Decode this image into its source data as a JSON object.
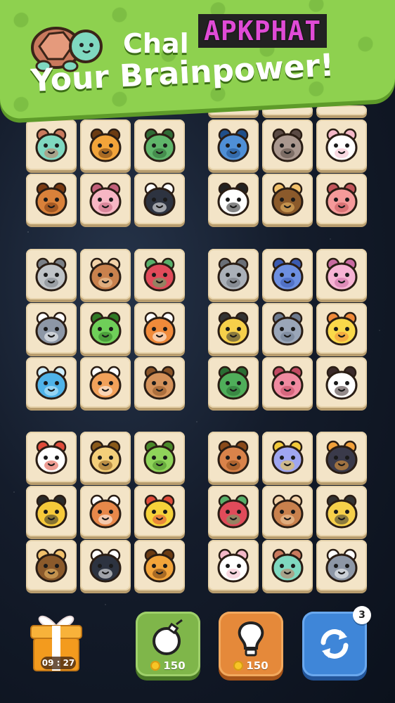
{
  "banner": {
    "headline_line1": "Chal",
    "headline_line2": "Your Brainpower!",
    "watermark": "APKPHAT"
  },
  "boards": [
    {
      "name": "board-top-left",
      "tiles": [
        "turtle",
        "tiger",
        "plant",
        "hedgehog",
        "pig",
        "penguin"
      ]
    },
    {
      "name": "board-top-right",
      "tiles": [
        "fish",
        "raccoon",
        "rabbit",
        "panda",
        "owl",
        "octopus"
      ]
    },
    {
      "name": "board-mid-left",
      "tiles": [
        "mouse",
        "monkey",
        "parrot",
        "wolf",
        "frog",
        "fox",
        "dolphin",
        "cat",
        "deer"
      ]
    },
    {
      "name": "board-mid-right",
      "tiles": [
        "koala",
        "blue-cat",
        "jellyfish",
        "angelfish",
        "elephant",
        "duck",
        "crocodile",
        "crab",
        "cow"
      ]
    },
    {
      "name": "board-bottom-left",
      "tiles": [
        "chicken",
        "leopard",
        "caterpillar",
        "bee",
        "shiba",
        "yellow-fish",
        "owl",
        "penguin",
        "tiger"
      ]
    },
    {
      "name": "board-bottom-right",
      "tiles": [
        "squirrel",
        "butterfly",
        "toucan",
        "parrot",
        "monkey",
        "angelfish",
        "rabbit",
        "turtle",
        "wolf"
      ]
    }
  ],
  "toolbar": {
    "gift_timer": "09 : 27",
    "bomb_cost": "150",
    "hint_cost": "150",
    "shuffle_count": "3"
  },
  "colors": {
    "banner_green": "#8ed14f",
    "tile_bg": "#f3e4c7",
    "bomb_btn": "#7fb64a",
    "hint_btn": "#e5893a",
    "shuffle_btn": "#3f86d8",
    "watermark_pink": "#e04bd6"
  }
}
